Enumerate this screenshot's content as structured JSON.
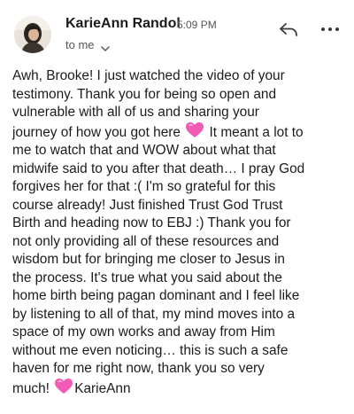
{
  "header": {
    "sender_name": "KarieAnn Randol",
    "time": "5:09 PM",
    "recipient": "to me"
  },
  "icons": {
    "reply": "reply-icon",
    "more": "more-icon",
    "recipient_chevron": "chevron-down-icon",
    "heart": "pink-heart-icon"
  },
  "colors": {
    "heart": "#f15bb5",
    "text": "#1b1b1b",
    "secondary": "#555555"
  },
  "message": {
    "line_01": "Awh, Brooke! I just watched the video of your",
    "line_02": "testimony. Thank you for being so open and",
    "line_03": "vulnerable with all of us and sharing your",
    "line_04": "journey of how you got here",
    "line_04b": "It meant a lot to",
    "line_05": "me to watch that and WOW about what that",
    "line_06": "midwife said to you after that death… I pray God",
    "line_07": "forgives her for that :( I'm so grateful for this",
    "line_08": "course already! Just finished Trust God Trust",
    "line_09": "Birth and heading now to EBJ :) Thank you for",
    "line_10": "not only providing all of these resources and",
    "line_11": "wisdom but for bringing me closer to Jesus in",
    "line_12": "the process. It's true what you said about the",
    "line_13": "home birth being pagan dominant and I feel like",
    "line_14": "by listening to all of that, my mind moves into a",
    "line_15": "space of my own works and away from Him",
    "line_16": "without me even noticing… this is such a safe",
    "line_17": "haven for me right now, thank you so very",
    "line_18a": "much!",
    "line_18b": "KarieAnn"
  }
}
